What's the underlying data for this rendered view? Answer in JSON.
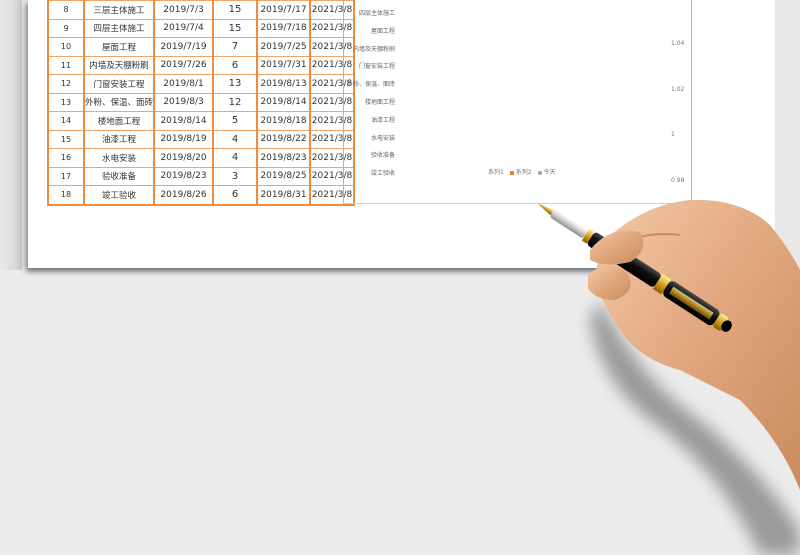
{
  "table": {
    "rows": [
      {
        "no": "8",
        "task": "三层主体施工",
        "start": "2019/7/3",
        "days": "15",
        "end": "2019/7/17",
        "today": "2021/3/8"
      },
      {
        "no": "9",
        "task": "四层主体施工",
        "start": "2019/7/4",
        "days": "15",
        "end": "2019/7/18",
        "today": "2021/3/8"
      },
      {
        "no": "10",
        "task": "屋面工程",
        "start": "2019/7/19",
        "days": "7",
        "end": "2019/7/25",
        "today": "2021/3/8"
      },
      {
        "no": "11",
        "task": "内墙及天棚粉刷",
        "start": "2019/7/26",
        "days": "6",
        "end": "2019/7/31",
        "today": "2021/3/8"
      },
      {
        "no": "12",
        "task": "门窗安装工程",
        "start": "2019/8/1",
        "days": "13",
        "end": "2019/8/13",
        "today": "2021/3/8"
      },
      {
        "no": "13",
        "task": "外粉、保温、面砖",
        "start": "2019/8/3",
        "days": "12",
        "end": "2019/8/14",
        "today": "2021/3/8"
      },
      {
        "no": "14",
        "task": "楼地面工程",
        "start": "2019/8/14",
        "days": "5",
        "end": "2019/8/18",
        "today": "2021/3/8"
      },
      {
        "no": "15",
        "task": "油漆工程",
        "start": "2019/8/19",
        "days": "4",
        "end": "2019/8/22",
        "today": "2021/3/8"
      },
      {
        "no": "16",
        "task": "水电安装",
        "start": "2019/8/20",
        "days": "4",
        "end": "2019/8/23",
        "today": "2021/3/8"
      },
      {
        "no": "17",
        "task": "验收准备",
        "start": "2019/8/23",
        "days": "3",
        "end": "2019/8/25",
        "today": "2021/3/8"
      },
      {
        "no": "18",
        "task": "竣工验收",
        "start": "2019/8/26",
        "days": "6",
        "end": "2019/8/31",
        "today": "2021/3/8"
      }
    ]
  },
  "chart": {
    "categories": [
      "四层主体施工",
      "屋面工程",
      "内墙及天棚粉刷",
      "门窗安装工程",
      "外粉、保温、面砖",
      "楼地面工程",
      "油漆工程",
      "水电安装",
      "验收准备",
      "竣工验收"
    ],
    "secondary_axis_ticks": [
      "1.04",
      "1.02",
      "1",
      "0.98"
    ],
    "legend": [
      "系列1",
      "系列2",
      "今天"
    ],
    "colors": {
      "series2": "#f07d2a",
      "today": "#a0a0a0",
      "frame": "#f2a56b"
    }
  },
  "decor": {
    "overlay": "hand-holding-fountain-pen"
  }
}
